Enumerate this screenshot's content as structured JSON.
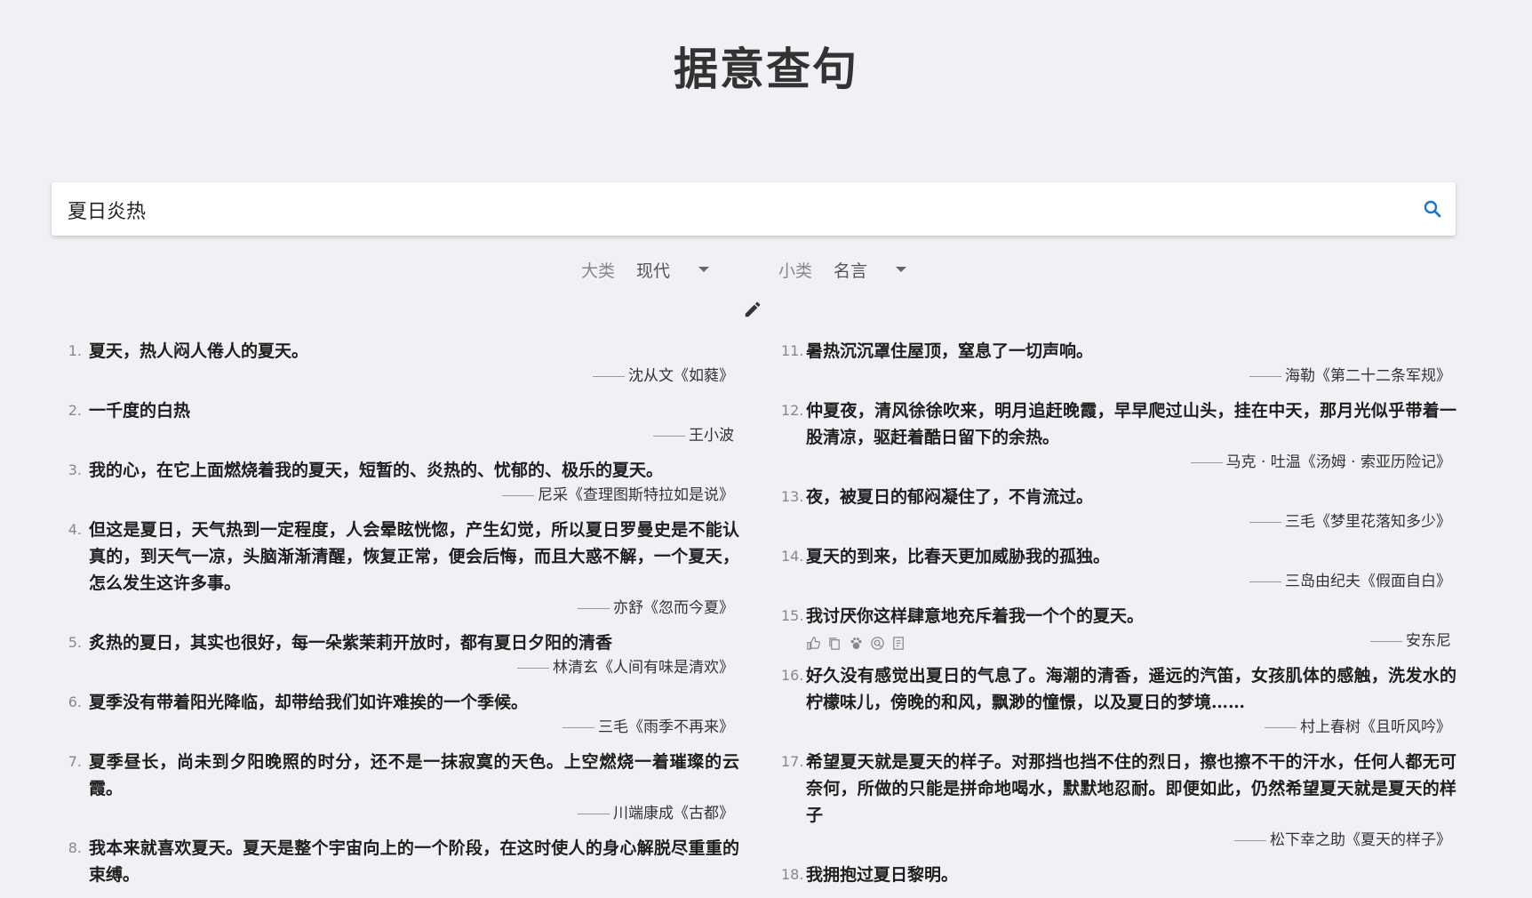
{
  "header": {
    "title": "据意查句"
  },
  "search": {
    "value": "夏日炎热"
  },
  "filters": {
    "category": {
      "label": "大类",
      "value": "现代"
    },
    "subcategory": {
      "label": "小类",
      "value": "名言"
    }
  },
  "icons": {
    "search": "search-icon",
    "edit": "pencil-icon",
    "caret": "caret-down-icon"
  },
  "colors": {
    "accent": "#1976d2",
    "background": "#eff1f4"
  },
  "results_left": [
    {
      "num": "1.",
      "text": "夏天，热人闷人倦人的夏天。",
      "source": "沈从文《如蕤》"
    },
    {
      "num": "2.",
      "text": "一千度的白热",
      "source": "王小波"
    },
    {
      "num": "3.",
      "text": "我的心，在它上面燃烧着我的夏天，短暂的、炎热的、忧郁的、极乐的夏天。",
      "source": "尼采《查理图斯特拉如是说》"
    },
    {
      "num": "4.",
      "text": "但这是夏日，天气热到一定程度，人会晕眩恍惚，产生幻觉，所以夏日罗曼史是不能认真的，到天气一凉，头脑渐渐清醒，恢复正常，便会后悔，而且大惑不解，一个夏天，怎么发生这许多事。",
      "source": "亦舒《忽而今夏》"
    },
    {
      "num": "5.",
      "text": "炙热的夏日，其实也很好，每一朵紫茉莉开放时，都有夏日夕阳的清香",
      "source": "林清玄《人间有味是清欢》"
    },
    {
      "num": "6.",
      "text": "夏季没有带着阳光降临，却带给我们如许难挨的一个季候。",
      "source": "三毛《雨季不再来》"
    },
    {
      "num": "7.",
      "text": "夏季昼长，尚未到夕阳晚照的时分，还不是一抹寂寞的天色。上空燃烧一着璀璨的云霞。",
      "source": "川端康成《古都》"
    },
    {
      "num": "8.",
      "text": "我本来就喜欢夏天。夏天是整个宇宙向上的一个阶段，在这时使人的身心解脱尽重重的束缚。",
      "source": ""
    }
  ],
  "results_right": [
    {
      "num": "11.",
      "text": "暑热沉沉罩住屋顶，窒息了一切声响。",
      "source": "海勒《第二十二条军规》"
    },
    {
      "num": "12.",
      "text": "仲夏夜，清风徐徐吹来，明月追赶晚霞，早早爬过山头，挂在中天，那月光似乎带着一股清凉，驱赶着酷日留下的余热。",
      "source": "马克 · 吐温《汤姆 · 索亚历险记》"
    },
    {
      "num": "13.",
      "text": "夜，被夏日的郁闷凝住了，不肯流过。",
      "source": "三毛《梦里花落知多少》"
    },
    {
      "num": "14.",
      "text": "夏天的到来，比春天更加威胁我的孤独。",
      "source": "三岛由纪夫《假面自白》"
    },
    {
      "num": "15.",
      "text": "我讨厌你这样肆意地充斥着我一个个的夏天。",
      "source": "安东尼",
      "actions": true
    },
    {
      "num": "16.",
      "text": "好久没有感觉出夏日的气息了。海潮的清香，遥远的汽笛，女孩肌体的感触，洗发水的柠檬味儿，傍晚的和风，飘渺的憧憬，以及夏日的梦境……",
      "source": "村上春树《且听风吟》"
    },
    {
      "num": "17.",
      "text": "希望夏天就是夏天的样子。对那挡也挡不住的烈日，擦也擦不干的汗水，任何人都无可奈何，所做的只能是拼命地喝水，默默地忍耐。即便如此，仍然希望夏天就是夏天的样子",
      "source": "松下幸之助《夏天的样子》"
    },
    {
      "num": "18.",
      "text": "我拥抱过夏日黎明。",
      "source": ""
    }
  ]
}
